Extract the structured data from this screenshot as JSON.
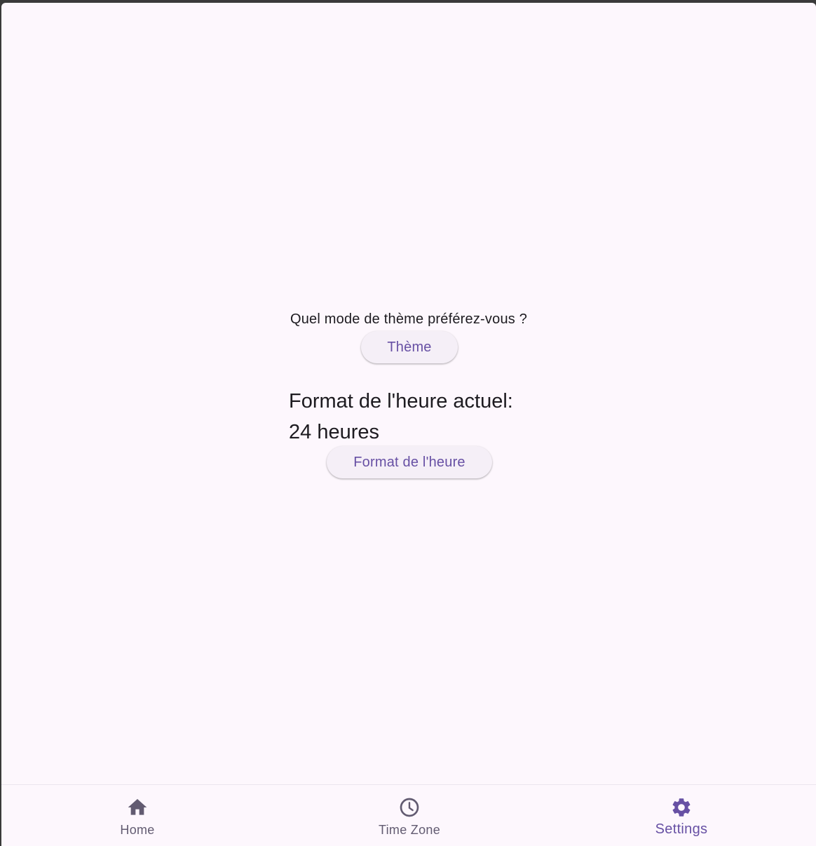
{
  "settings": {
    "theme_question": "Quel mode de thème préférez-vous ?",
    "theme_button_label": "Thème",
    "time_format_label": "Format de l'heure actuel:",
    "time_format_value": "24 heures",
    "time_format_button_label": "Format de l'heure"
  },
  "nav": {
    "items": [
      {
        "label": "Home",
        "icon": "home-icon",
        "active": false
      },
      {
        "label": "Time Zone",
        "icon": "clock-icon",
        "active": false
      },
      {
        "label": "Settings",
        "icon": "gear-icon",
        "active": true
      }
    ]
  },
  "colors": {
    "background": "#fdf7fd",
    "accent": "#6750a4",
    "inactive": "#625b71",
    "text": "#1d1b20",
    "button_bg": "#f5eff7"
  }
}
